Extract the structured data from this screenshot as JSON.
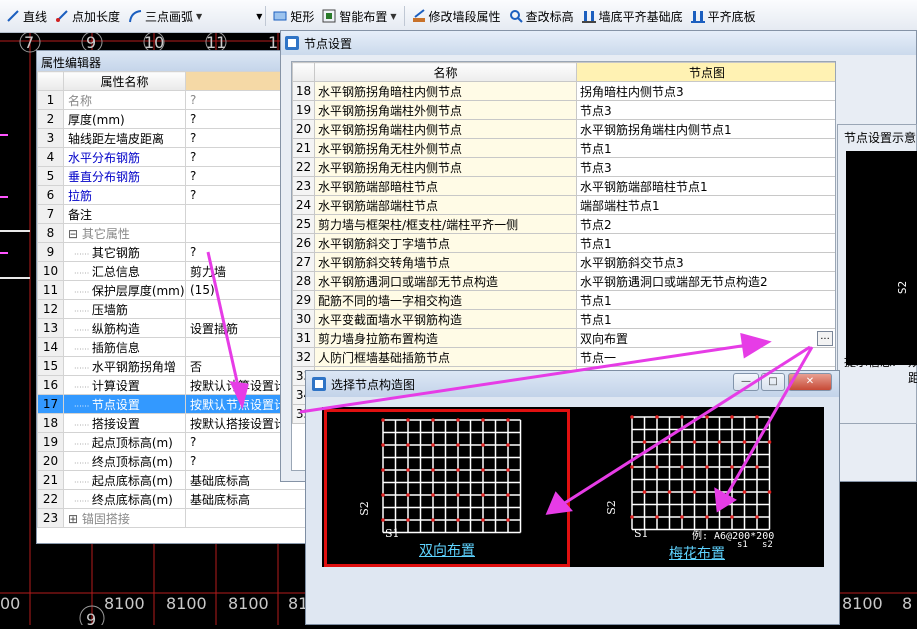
{
  "toolbar": {
    "items": [
      {
        "label": "直线",
        "icon": "line-icon"
      },
      {
        "label": "点加长度",
        "icon": "point-length-icon"
      },
      {
        "label": "三点画弧",
        "icon": "arc-icon"
      },
      {
        "label": "矩形",
        "icon": "rectangle-icon"
      },
      {
        "label": "智能布置",
        "icon": "smart-layout-icon"
      },
      {
        "label": "修改墙段属性",
        "icon": "wall-props-icon"
      },
      {
        "label": "查改标高",
        "icon": "elevation-icon"
      },
      {
        "label": "墙底平齐基础底",
        "icon": "wall-bottom-icon"
      },
      {
        "label": "平齐底板",
        "icon": "flush-slab-icon"
      }
    ]
  },
  "cad": {
    "top_axis": [
      "7",
      "9",
      "10",
      "11",
      "1"
    ],
    "bottom_dims": [
      "00",
      "8100",
      "8100",
      "8100",
      "81",
      "8100",
      "8"
    ],
    "bottom_axis": "9",
    "colors": {
      "grid": "#b41b1b",
      "axis_text": "#c9c9c9",
      "arrow": "#e63ce6"
    }
  },
  "property_editor": {
    "title": "属性编辑器",
    "col_name": "属性名称",
    "rows": [
      {
        "n": "1",
        "name": "名称",
        "value": "?",
        "style": "gray"
      },
      {
        "n": "2",
        "name": "厚度(mm)",
        "value": "?",
        "style": ""
      },
      {
        "n": "3",
        "name": "轴线距左墙皮距离",
        "value": "?",
        "style": ""
      },
      {
        "n": "4",
        "name": "水平分布钢筋",
        "value": "?",
        "style": "blue"
      },
      {
        "n": "5",
        "name": "垂直分布钢筋",
        "value": "?",
        "style": "blue"
      },
      {
        "n": "6",
        "name": "拉筋",
        "value": "?",
        "style": "blue"
      },
      {
        "n": "7",
        "name": "备注",
        "value": "",
        "style": ""
      },
      {
        "n": "8",
        "name": "其它属性",
        "value": "",
        "style": "group"
      },
      {
        "n": "9",
        "name": "其它钢筋",
        "value": "?",
        "style": "child"
      },
      {
        "n": "10",
        "name": "汇总信息",
        "value": "剪力墙",
        "style": "child"
      },
      {
        "n": "11",
        "name": "保护层厚度(mm)",
        "value": "(15)",
        "style": "child"
      },
      {
        "n": "12",
        "name": "压墙筋",
        "value": "",
        "style": "child"
      },
      {
        "n": "13",
        "name": "纵筋构造",
        "value": "设置插筋",
        "style": "child"
      },
      {
        "n": "14",
        "name": "插筋信息",
        "value": "",
        "style": "child"
      },
      {
        "n": "15",
        "name": "水平钢筋拐角增",
        "value": "否",
        "style": "child"
      },
      {
        "n": "16",
        "name": "计算设置",
        "value": "按默认计算设置计",
        "style": "child"
      },
      {
        "n": "17",
        "name": "节点设置",
        "value": "按默认节点设置计",
        "style": "selected"
      },
      {
        "n": "18",
        "name": "搭接设置",
        "value": "按默认搭接设置计",
        "style": "child"
      },
      {
        "n": "19",
        "name": "起点顶标高(m)",
        "value": "?",
        "style": "child"
      },
      {
        "n": "20",
        "name": "终点顶标高(m)",
        "value": "?",
        "style": "child"
      },
      {
        "n": "21",
        "name": "起点底标高(m)",
        "value": "基础底标高",
        "style": "child"
      },
      {
        "n": "22",
        "name": "终点底标高(m)",
        "value": "基础底标高",
        "style": "child"
      },
      {
        "n": "23",
        "name": "锚固搭接",
        "value": "",
        "style": "group"
      }
    ]
  },
  "node_settings": {
    "title": "节点设置",
    "col_name": "名称",
    "col_diagram": "节点图",
    "rows": [
      {
        "n": "18",
        "name": "水平钢筋拐角暗柱内侧节点",
        "value": "拐角暗柱内侧节点3"
      },
      {
        "n": "19",
        "name": "水平钢筋拐角端柱外侧节点",
        "value": "节点3"
      },
      {
        "n": "20",
        "name": "水平钢筋拐角端柱内侧节点",
        "value": "水平钢筋拐角端柱内侧节点1"
      },
      {
        "n": "21",
        "name": "水平钢筋拐角无柱外侧节点",
        "value": "节点1"
      },
      {
        "n": "22",
        "name": "水平钢筋拐角无柱内侧节点",
        "value": "节点3"
      },
      {
        "n": "23",
        "name": "水平钢筋端部暗柱节点",
        "value": "水平钢筋端部暗柱节点1"
      },
      {
        "n": "24",
        "name": "水平钢筋端部端柱节点",
        "value": "端部端柱节点1"
      },
      {
        "n": "25",
        "name": "剪力墙与框架柱/框支柱/端柱平齐一侧",
        "value": "节点2"
      },
      {
        "n": "26",
        "name": "水平钢筋斜交丁字墙节点",
        "value": "节点1"
      },
      {
        "n": "27",
        "name": "水平钢筋斜交转角墙节点",
        "value": "水平钢筋斜交节点3"
      },
      {
        "n": "28",
        "name": "水平钢筋遇洞口或端部无节点构造",
        "value": "水平钢筋遇洞口或端部无节点构造2"
      },
      {
        "n": "29",
        "name": "配筋不同的墙一字相交构造",
        "value": "节点1"
      },
      {
        "n": "30",
        "name": "水平变截面墙水平钢筋构造",
        "value": "节点1"
      },
      {
        "n": "31",
        "name": "剪力墙身拉筋布置构造",
        "value": "双向布置"
      },
      {
        "n": "32",
        "name": "人防门框墙基础插筋节点",
        "value": "节点一"
      },
      {
        "n": "33",
        "name": "",
        "value": ""
      },
      {
        "n": "34",
        "name": "",
        "value": ""
      },
      {
        "n": "35",
        "name": "",
        "value": ""
      }
    ],
    "ellipsis": "...",
    "preview": {
      "title": "节点设置示意",
      "hint_label": "提示信息:",
      "hint_text": "双",
      "hint_text2": "距",
      "s2": "S2"
    }
  },
  "choose_dialog": {
    "title": "选择节点构造图",
    "options": [
      {
        "label": "双向布置",
        "s1": "S1",
        "s2": "S2",
        "selected": true
      },
      {
        "label": "梅花布置",
        "s1": "S1",
        "s2": "S2",
        "example": "例: A6@200*200",
        "ex_s1": "s1",
        "ex_s2": "s2",
        "selected": false
      }
    ]
  }
}
